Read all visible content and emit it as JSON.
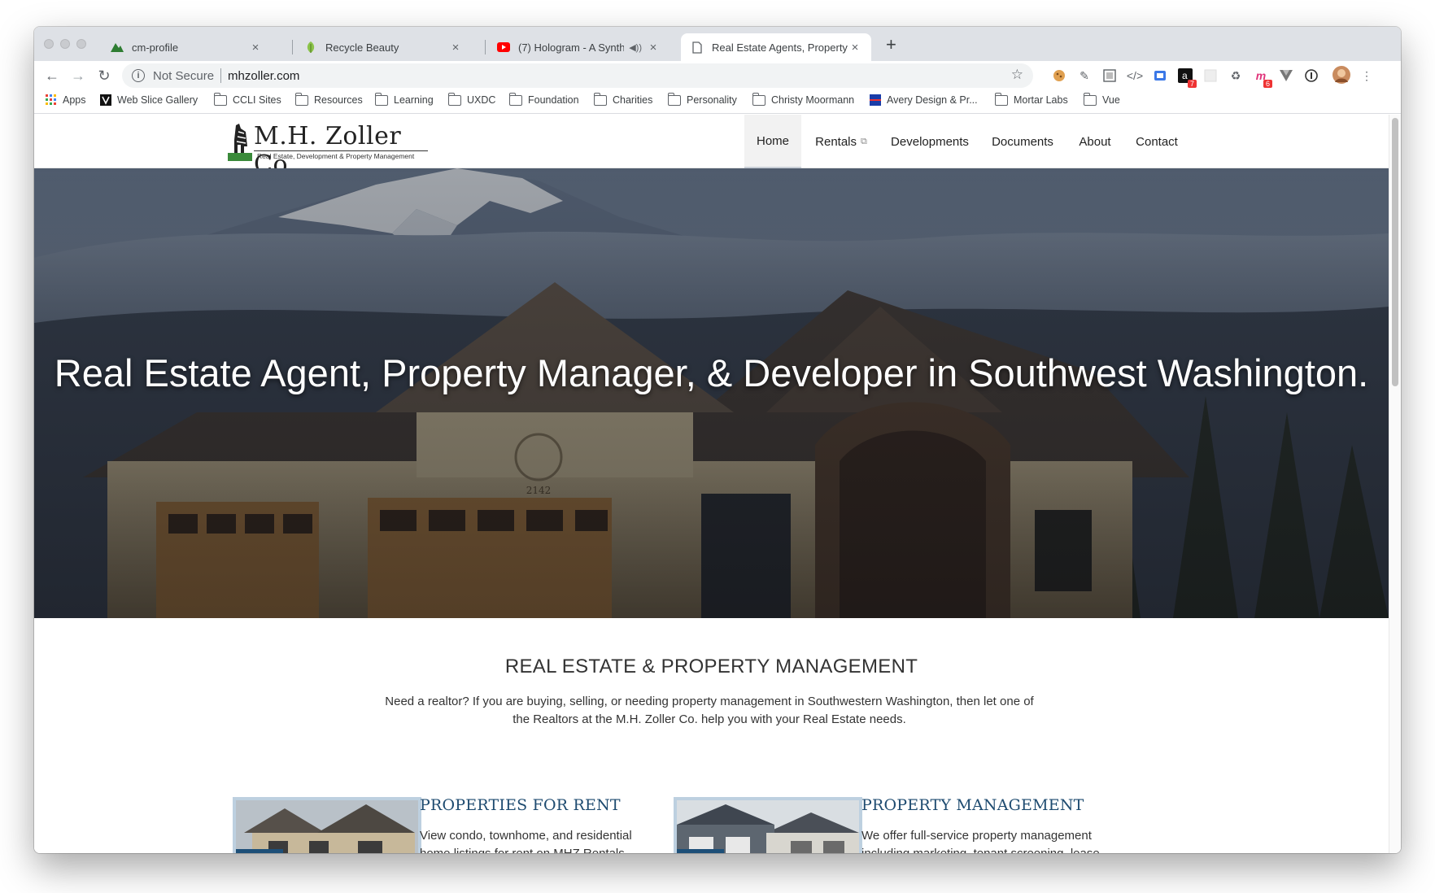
{
  "browser": {
    "tabs": [
      {
        "title": "cm-profile",
        "icon": "mountain-icon"
      },
      {
        "title": "Recycle Beauty",
        "icon": "leaf-icon"
      },
      {
        "title": "(7) Hologram - A Synthwav",
        "icon": "youtube-icon",
        "audio": true
      },
      {
        "title": "Real Estate Agents, Property M",
        "icon": "page-icon",
        "active": true
      }
    ],
    "address": {
      "security": "Not Secure",
      "url": "mhzoller.com"
    },
    "extension_badges": {
      "amazon": "7",
      "mortar": "6"
    },
    "bookmarks": [
      "Apps",
      "Web Slice Gallery",
      "CCLI Sites",
      "Resources",
      "Learning",
      "UXDC",
      "Foundation",
      "Charities",
      "Personality",
      "Christy Moormann",
      "Avery Design & Pr...",
      "Mortar Labs",
      "Vue"
    ]
  },
  "site": {
    "logo_name": "M.H. Zoller Co.",
    "logo_tagline": "Real Estate, Development & Property Management",
    "nav": [
      "Home",
      "Rentals",
      "Developments",
      "Documents",
      "About",
      "Contact"
    ],
    "nav_active": "Home",
    "hero_title": "Real Estate Agent, Property Manager, & Developer in Southwest Washington.",
    "house_number": "2142",
    "section_title": "REAL ESTATE & PROPERTY MANAGEMENT",
    "section_intro": "Need a realtor? If you are buying, selling, or needing property management in Southwestern Washington, then let one of the Realtors at the M.H. Zoller Co. help you with your Real Estate needs.",
    "cards": [
      {
        "title": "PROPERTIES FOR RENT",
        "text": "View condo, townhome, and residential home listings for rent on MHZ Rentals."
      },
      {
        "title": "PROPERTY MANAGEMENT",
        "text": "We offer full-service property management including marketing, tenant screening, lease paperwork, and more."
      }
    ]
  },
  "colors": {
    "accent": "#1e4b70",
    "badge": "#1d4f78",
    "card_border": "#bdd0e0"
  }
}
